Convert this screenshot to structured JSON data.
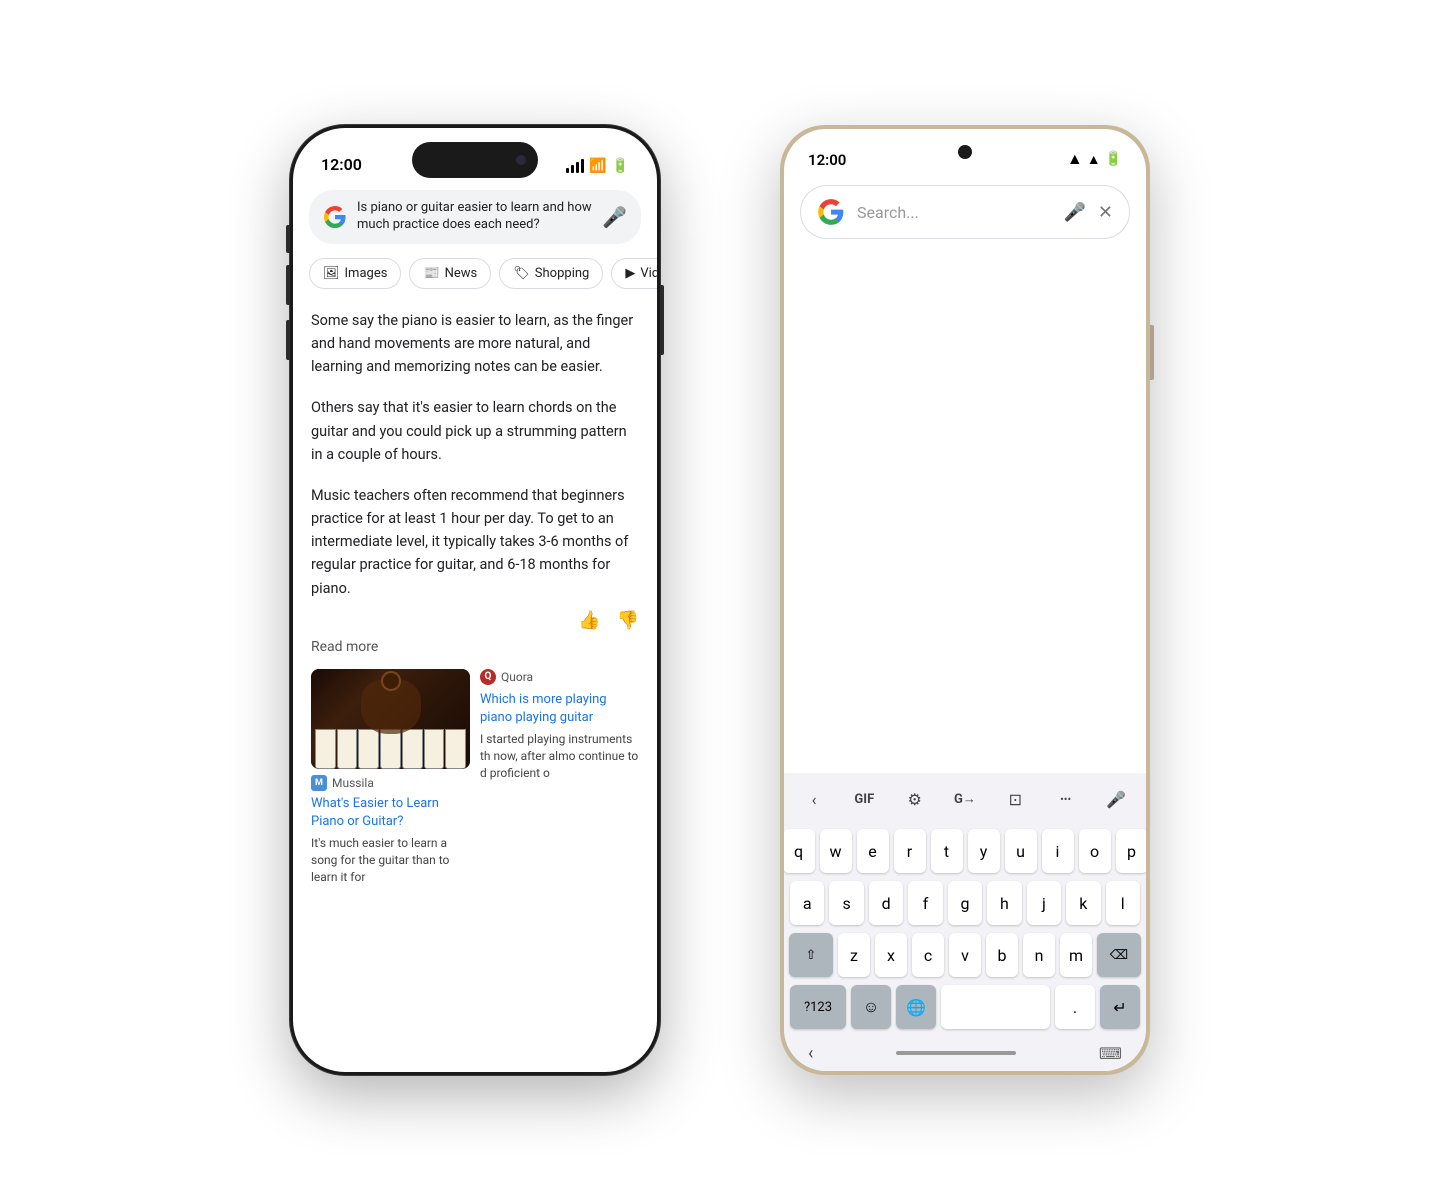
{
  "iphone": {
    "status": {
      "time": "12:00"
    },
    "search": {
      "query": "Is piano or guitar easier to learn and how much practice does each need?",
      "mic_label": "mic"
    },
    "filter_tabs": [
      {
        "label": "Images",
        "icon": "🖼"
      },
      {
        "label": "News",
        "icon": "📰"
      },
      {
        "label": "Shopping",
        "icon": "🏷"
      },
      {
        "label": "Vide",
        "icon": "▶"
      }
    ],
    "paragraphs": [
      "Some say the piano is easier to learn, as the finger and hand movements are more natural, and learning and memorizing notes can be easier.",
      "Others say that it's easier to learn chords on the guitar and you could pick up a strumming pattern in a couple of hours.",
      "Music teachers often recommend that beginners practice for at least 1 hour per day. To get to an intermediate level, it typically takes 3-6 months of regular practice for guitar, and 6-18 months for piano."
    ],
    "read_more": "Read more",
    "source1": {
      "logo": "M",
      "name": "Mussila",
      "title": "What's Easier to Learn Piano or Guitar?",
      "snippet": "It's much easier to learn a song for the guitar than to learn it for"
    },
    "source2": {
      "logo": "Q",
      "name": "Quora",
      "title": "Which is more playing piano playing guitar",
      "snippet": "I started playing instruments th now, after almo continue to d proficient o"
    }
  },
  "android": {
    "status": {
      "time": "12:00"
    },
    "search": {
      "placeholder": "Search...",
      "mic_label": "mic",
      "close_label": "close"
    },
    "keyboard": {
      "toolbar": {
        "back": "‹",
        "gif": "GIF",
        "settings": "⚙",
        "translate": "G→",
        "clipboard": "⊡",
        "more": "•••",
        "mic": "🎤"
      },
      "rows": [
        [
          "q",
          "w",
          "e",
          "r",
          "t",
          "y",
          "u",
          "i",
          "o",
          "p"
        ],
        [
          "a",
          "s",
          "d",
          "f",
          "g",
          "h",
          "j",
          "k",
          "l"
        ],
        [
          "⇧",
          "z",
          "x",
          "c",
          "v",
          "b",
          "n",
          "m",
          "⌫"
        ],
        [
          "?123",
          "☺",
          "🌐",
          " ",
          ".",
          "↵"
        ]
      ]
    },
    "nav": {
      "chevron": "‹",
      "keyboard": "⌨"
    }
  }
}
